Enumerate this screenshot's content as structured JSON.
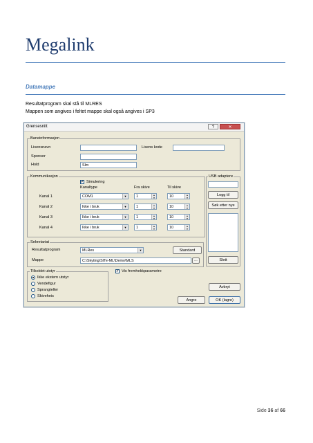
{
  "document": {
    "title": "Megalink",
    "section": "Datamappe",
    "paragraph_line1": "Resultatprogram skal stå til MLRES",
    "paragraph_line2": "Mappen som angives i feltet mappe skal også angives i SP3",
    "footer": {
      "prefix": "Side ",
      "page": "36",
      "middle": " af ",
      "total": "66"
    }
  },
  "dialog": {
    "title": "Grensesnitt",
    "help_label": "?",
    "close_label": "✕",
    "baneinfo": {
      "legend": "Baneinformasjon",
      "lisensnavn_label": "Lisensnavn",
      "lisensnavn_value": "",
      "lisenskode_label": "Lisens kode",
      "lisenskode_value": "",
      "sponsor_label": "Sponsor",
      "sponsor_value": "",
      "hold_label": "Hold",
      "hold_value": "Slm"
    },
    "kommunikasjon": {
      "legend": "Kommunikasjon",
      "simulering_label": "Simulering",
      "simulering_checked": "✔",
      "col_kanaltype": "Kanaltype",
      "col_fra": "Fra skive",
      "col_til": "Til skive",
      "rows": [
        {
          "label": "Kanal 1",
          "type": "COM1",
          "fra": "1",
          "til": "10"
        },
        {
          "label": "Kanal 2",
          "type": "Ikke i bruk",
          "fra": "1",
          "til": "10"
        },
        {
          "label": "Kanal 3",
          "type": "Ikke i bruk",
          "fra": "1",
          "til": "10"
        },
        {
          "label": "Kanal 4",
          "type": "Ikke i bruk",
          "fra": "1",
          "til": "10"
        }
      ]
    },
    "usb": {
      "legend": "USB adaptere",
      "input_value": "",
      "logg_til_label": "Logg til",
      "sok_label": "Søk etter nye",
      "slett_label": "Slett"
    },
    "sekretariat": {
      "legend": "Sekretariat",
      "resultatprogram_label": "Resultatprogram",
      "resultatprogram_value": "MLRes",
      "standard_label": "Standard",
      "mappe_label": "Mappe",
      "mappe_value": "C:\\Skyting\\SITe-ML\\Demo\\MLS",
      "browse_label": "..."
    },
    "tilkoblet": {
      "legend": "Tilkoblet utstyr",
      "options": [
        {
          "label": "Ikke ekstern utstyr",
          "selected": true
        },
        {
          "label": "Vendefigur",
          "selected": false
        },
        {
          "label": "Sprangteller",
          "selected": false
        },
        {
          "label": "Skiveheis",
          "selected": false
        }
      ]
    },
    "vis_label": "Vis fremhekkparametre",
    "vis_checked": "✔",
    "avbryt_label": "Avbryt",
    "angre_label": "Angre",
    "ok_label": "OK (lagre)"
  }
}
